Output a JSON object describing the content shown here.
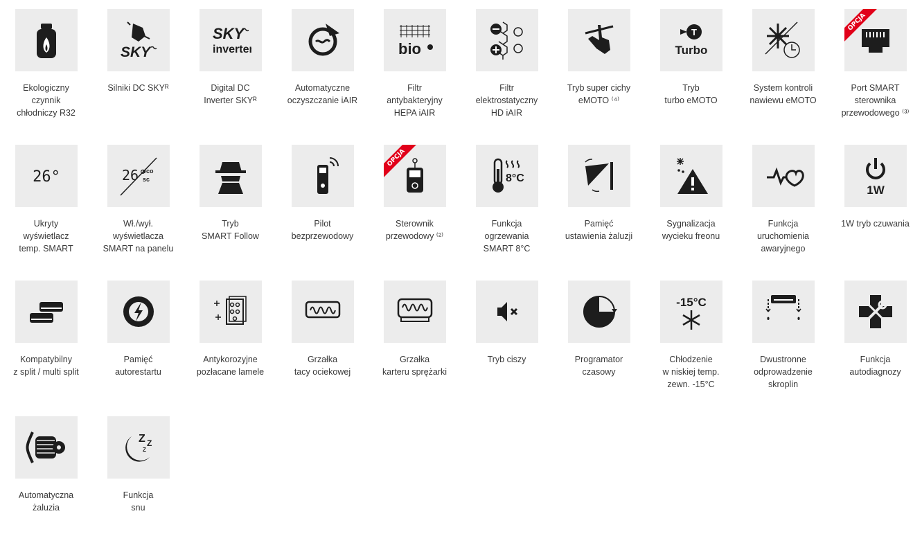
{
  "colors": {
    "tile_bg": "#ececec",
    "icon": "#1d1d1d",
    "badge": "#e1001a",
    "text": "#3a3a3a"
  },
  "badge_label": "OPCJA",
  "features": [
    {
      "icon": "gas-cylinder-icon",
      "label": "Ekologiczny\nczynnik\nchłodniczy R32",
      "badge": false
    },
    {
      "icon": "sky-fan-icon",
      "label": "Silniki DC SKYᴿ",
      "badge": false
    },
    {
      "icon": "sky-inverter-icon",
      "label": "Digital DC\nInverter SKYᴿ",
      "badge": false
    },
    {
      "icon": "auto-clean-icon",
      "label": "Automatyczne\noczyszczanie iAIR",
      "badge": false
    },
    {
      "icon": "bio-filter-icon",
      "label": "Filtr\nantybakteryjny\nHEPA iAIR",
      "badge": false
    },
    {
      "icon": "electrostatic-filter-icon",
      "label": "Filtr\nelektrostatyczny\nHD iAIR",
      "badge": false
    },
    {
      "icon": "silent-hand-icon",
      "label": "Tryb super cichy\neMOTO ⁽⁴⁾",
      "badge": false
    },
    {
      "icon": "turbo-icon",
      "label": "Tryb\nturbo eMOTO",
      "badge": false
    },
    {
      "icon": "airflow-timer-icon",
      "label": "System kontroli\nnawiewu eMOTO",
      "badge": false
    },
    {
      "icon": "ethernet-port-icon",
      "label": "Port SMART\nsterownika\nprzewodowego ⁽³⁾",
      "badge": true
    },
    {
      "icon": "temp-display-icon",
      "label": "Ukryty\nwyświetlacz\ntemp. SMART",
      "badge": false
    },
    {
      "icon": "display-toggle-icon",
      "label": "Wł./wył.\nwyświetlacza\nSMART na panelu",
      "badge": false
    },
    {
      "icon": "spy-icon",
      "label": "Tryb\nSMART Follow",
      "badge": false
    },
    {
      "icon": "remote-control-icon",
      "label": "Pilot\nbezprzewodowy",
      "badge": false
    },
    {
      "icon": "wired-controller-icon",
      "label": "Sterownik\nprzewodowy ⁽²⁾",
      "badge": true
    },
    {
      "icon": "thermometer-8c-icon",
      "label": "Funkcja\nogrzewania\nSMART 8°C",
      "badge": false
    },
    {
      "icon": "louver-memory-icon",
      "label": "Pamięć\nustawienia żaluzji",
      "badge": false
    },
    {
      "icon": "leak-warning-icon",
      "label": "Sygnalizacja\nwycieku freonu",
      "badge": false
    },
    {
      "icon": "heartbeat-icon",
      "label": "Funkcja\nuruchomienia\nawaryjnego",
      "badge": false
    },
    {
      "icon": "standby-power-icon",
      "label": "1W tryb czuwania",
      "badge": false
    },
    {
      "icon": "multi-split-icon",
      "label": "Kompatybilny\nz split / multi split",
      "badge": false
    },
    {
      "icon": "auto-restart-icon",
      "label": "Pamięć\nautorestartu",
      "badge": false
    },
    {
      "icon": "gold-fins-icon",
      "label": "Antykorozyjne\npozłacane lamele",
      "badge": false
    },
    {
      "icon": "tray-heater-icon",
      "label": "Grzałka\ntacy ociekowej",
      "badge": false
    },
    {
      "icon": "crankcase-heater-icon",
      "label": "Grzałka\nkarteru sprężarki",
      "badge": false
    },
    {
      "icon": "mute-icon",
      "label": "Tryb ciszy",
      "badge": false
    },
    {
      "icon": "timer-icon",
      "label": "Programator\nczasowy",
      "badge": false
    },
    {
      "icon": "low-temp-cooling-icon",
      "label": "Chłodzenie\nw niskiej temp.\nzewn. -15°C",
      "badge": false
    },
    {
      "icon": "dual-drain-icon",
      "label": "Dwustronne\nodprowadzenie\nskroplin",
      "badge": false
    },
    {
      "icon": "self-diagnosis-icon",
      "label": "Funkcja\nautodiagnozy",
      "badge": false
    },
    {
      "icon": "auto-louver-icon",
      "label": "Automatyczna\nżaluzia",
      "badge": false
    },
    {
      "icon": "sleep-icon",
      "label": "Funkcja\nsnu",
      "badge": false
    }
  ],
  "icon_text": {
    "sky": "SKY",
    "inverter": "inverter",
    "bio": "bio",
    "turbo_t": "T",
    "turbo": "Turbo",
    "temp": "26°",
    "eco": "eco",
    "sc": "sc",
    "heat": "8°C",
    "watt": "1W",
    "minus15": "-15°C",
    "zz": "Z"
  }
}
